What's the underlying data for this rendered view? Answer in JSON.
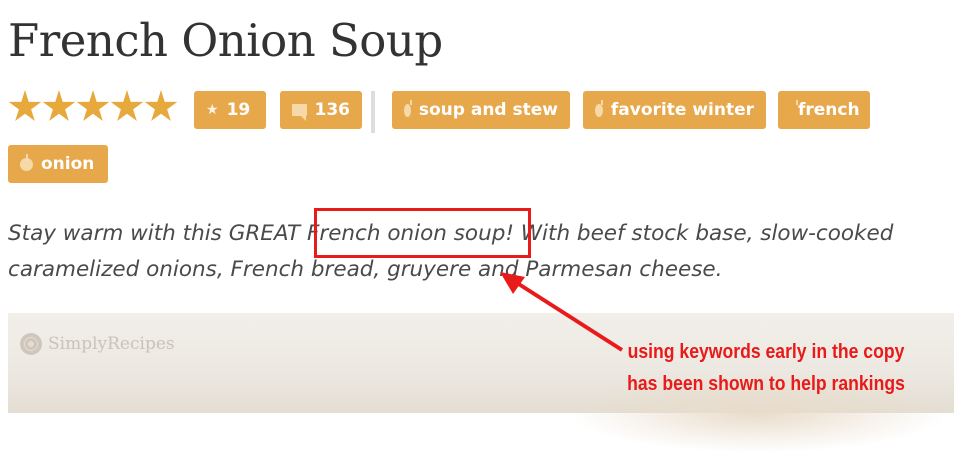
{
  "title": "French Onion Soup",
  "rating": {
    "stars": 5,
    "max": 5
  },
  "badges": {
    "rating_count": "19",
    "comment_count": "136",
    "tags": [
      "soup and stew",
      "favorite winter",
      "french",
      "onion"
    ]
  },
  "description": {
    "before": "Stay warm with this GREAT ",
    "keyword": "French onion soup!",
    "after": " With beef stock base, slow-cooked caramelized onions, French bread, gruyere and Parmesan cheese."
  },
  "hero": {
    "logo_text": "SimplyRecipes"
  },
  "annotation": {
    "line1": "using keywords early in the copy",
    "line2": "has been shown to help rankings"
  },
  "colors": {
    "accent": "#e7a84b",
    "annotation": "#e81a1a",
    "star": "#e8a93c"
  },
  "icons": [
    "star-icon",
    "comment-icon",
    "apple-icon",
    "flower-logo-icon"
  ]
}
